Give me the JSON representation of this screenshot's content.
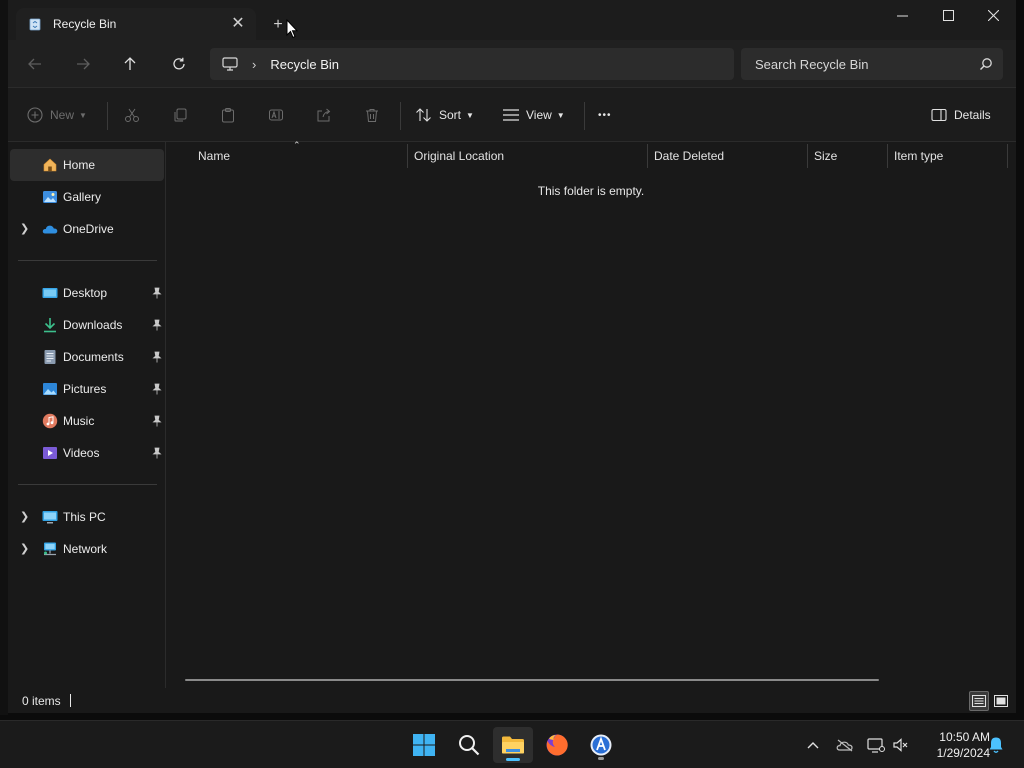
{
  "window": {
    "tab_title": "Recycle Bin",
    "tab_close": "✕",
    "new_tab": "+"
  },
  "nav": {
    "breadcrumb_sep": "›",
    "breadcrumb_current": "Recycle Bin",
    "search_placeholder": "Search Recycle Bin"
  },
  "commands": {
    "new_label": "New",
    "sort_label": "Sort",
    "view_label": "View",
    "more_label": "•••",
    "details_label": "Details"
  },
  "sidebar": {
    "items": [
      {
        "label": "Home"
      },
      {
        "label": "Gallery"
      },
      {
        "label": "OneDrive"
      },
      {
        "label": "Desktop"
      },
      {
        "label": "Downloads"
      },
      {
        "label": "Documents"
      },
      {
        "label": "Pictures"
      },
      {
        "label": "Music"
      },
      {
        "label": "Videos"
      },
      {
        "label": "This PC"
      },
      {
        "label": "Network"
      }
    ]
  },
  "content": {
    "columns": [
      "Name",
      "Original Location",
      "Date Deleted",
      "Size",
      "Item type"
    ],
    "empty_message": "This folder is empty."
  },
  "status": {
    "item_count": "0 items"
  },
  "taskbar": {
    "time": "10:50 AM",
    "date": "1/29/2024"
  },
  "colors": {
    "accent": "#4cc2ff",
    "window_bg": "#191919",
    "selected_bg": "#2d2d2d"
  }
}
